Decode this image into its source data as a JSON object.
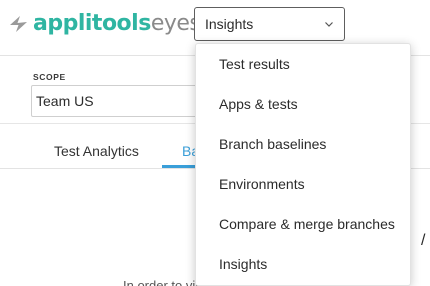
{
  "header": {
    "logo_brand": "applitools",
    "logo_product": "eyes",
    "view_selector": {
      "value": "Insights"
    }
  },
  "scope": {
    "label": "SCOPE",
    "value": "Team US"
  },
  "tabs": [
    {
      "label": "Test Analytics"
    },
    {
      "label": "Ba"
    }
  ],
  "main": {
    "partial_glyph": "/",
    "partial_message": "In order to view information regarding your batch"
  },
  "menu": {
    "items": [
      {
        "label": "Test results"
      },
      {
        "label": "Apps & tests"
      },
      {
        "label": "Branch baselines"
      },
      {
        "label": "Environments"
      },
      {
        "label": "Compare & merge branches"
      },
      {
        "label": "Insights"
      }
    ]
  },
  "colors": {
    "brand": "#2fb5a2",
    "accent": "#3a9fd9"
  },
  "icons": {
    "logo": "applitools-logo-icon",
    "select_arrow": "chevron-down-icon"
  }
}
